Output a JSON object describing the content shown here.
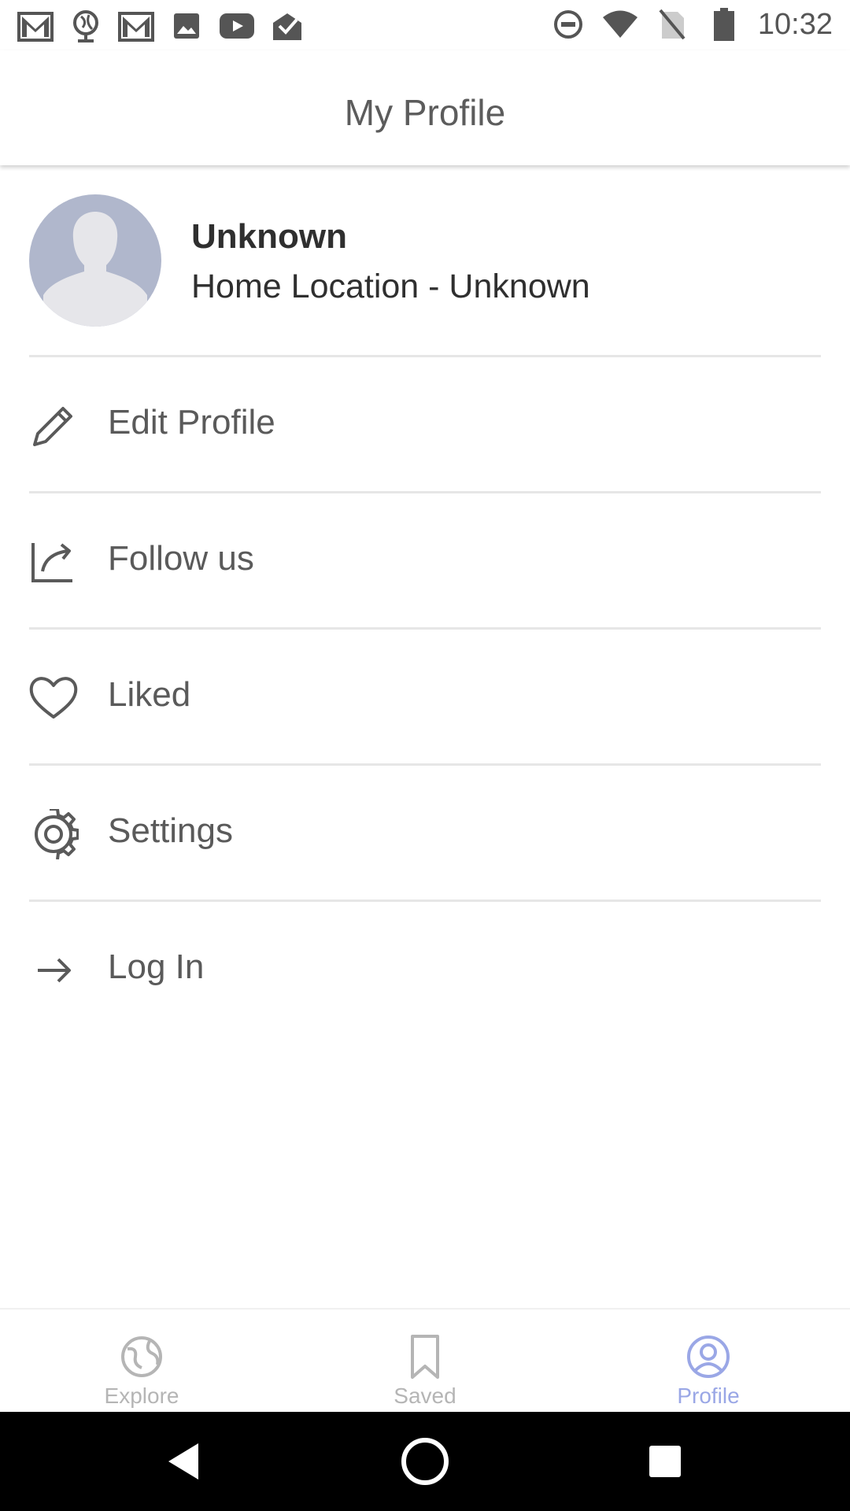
{
  "status_bar": {
    "time": "10:32",
    "left_icons": [
      "gmail-icon",
      "globe-icon",
      "gmail-icon",
      "image-icon",
      "youtube-icon",
      "mail-done-icon"
    ],
    "right_icons": [
      "do-not-disturb-icon",
      "wifi-icon",
      "no-sim-icon",
      "battery-icon"
    ]
  },
  "header": {
    "title": "My Profile"
  },
  "profile": {
    "name": "Unknown",
    "home_location": "Home Location - Unknown"
  },
  "menu": {
    "items": [
      {
        "label": "Edit Profile",
        "icon": "pencil-icon"
      },
      {
        "label": "Follow us",
        "icon": "share-chart-icon"
      },
      {
        "label": "Liked",
        "icon": "heart-icon"
      },
      {
        "label": "Settings",
        "icon": "gear-icon"
      },
      {
        "label": "Log In",
        "icon": "arrow-right-icon"
      }
    ]
  },
  "bottom_nav": {
    "items": [
      {
        "label": "Explore",
        "icon": "globe-icon",
        "active": false
      },
      {
        "label": "Saved",
        "icon": "bookmark-icon",
        "active": false
      },
      {
        "label": "Profile",
        "icon": "user-circle-icon",
        "active": true
      }
    ]
  },
  "colors": {
    "accent": "#9aa7e6",
    "avatar_bg": "#b0b7cc",
    "inactive": "#b5b5b5"
  }
}
